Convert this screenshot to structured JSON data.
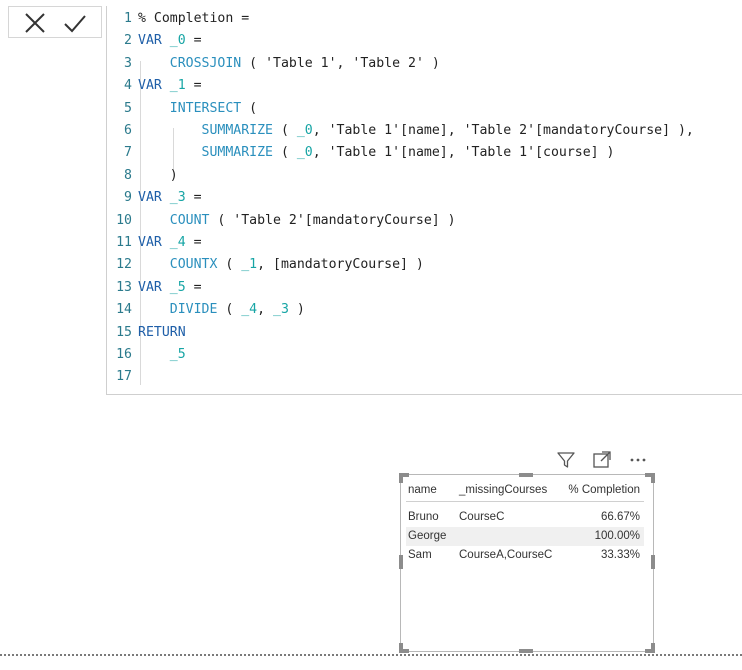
{
  "formula_bar": {
    "lines": [
      {
        "n": "1",
        "t": "% Completion ="
      },
      {
        "n": "2",
        "t": "VAR _0 ="
      },
      {
        "n": "3",
        "t": "    CROSSJOIN ( 'Table 1', 'Table 2' )"
      },
      {
        "n": "4",
        "t": "VAR _1 ="
      },
      {
        "n": "5",
        "t": "    INTERSECT ("
      },
      {
        "n": "6",
        "t": "        SUMMARIZE ( _0, 'Table 1'[name], 'Table 2'[mandatoryCourse] ),"
      },
      {
        "n": "7",
        "t": "        SUMMARIZE ( _0, 'Table 1'[name], 'Table 1'[course] )"
      },
      {
        "n": "8",
        "t": "    )"
      },
      {
        "n": "9",
        "t": "VAR _3 ="
      },
      {
        "n": "10",
        "t": "    COUNT ( 'Table 2'[mandatoryCourse] )"
      },
      {
        "n": "11",
        "t": "VAR _4 ="
      },
      {
        "n": "12",
        "t": "    COUNTX ( _1, [mandatoryCourse] )"
      },
      {
        "n": "13",
        "t": "VAR _5 ="
      },
      {
        "n": "14",
        "t": "    DIVIDE ( _4, _3 )"
      },
      {
        "n": "15",
        "t": "RETURN"
      },
      {
        "n": "16",
        "t": "    _5"
      },
      {
        "n": "17",
        "t": ""
      }
    ]
  },
  "icons": {
    "cancel": "close-icon",
    "commit": "checkmark-icon",
    "filter": "filter-icon",
    "focus": "focus-mode-icon",
    "more": "more-options-icon"
  },
  "table": {
    "headers": [
      "name",
      "_missingCourses",
      "% Completion"
    ],
    "rows": [
      [
        "Bruno",
        "CourseC",
        "66.67%"
      ],
      [
        "George",
        "",
        "100.00%"
      ],
      [
        "Sam",
        "CourseA,CourseC",
        "33.33%"
      ]
    ]
  },
  "colors": {
    "keyword": "#1f5fa8",
    "function": "#2a8fbd",
    "variable": "#17a5a5",
    "line_number": "#2b7a8c"
  }
}
